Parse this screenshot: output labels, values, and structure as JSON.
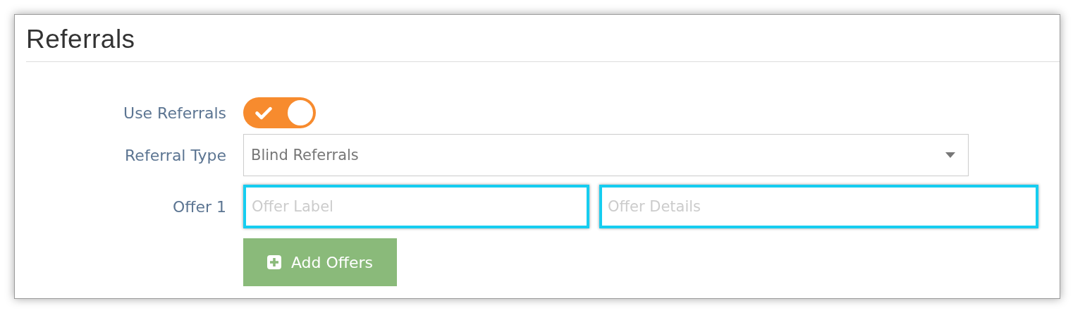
{
  "panel": {
    "title": "Referrals"
  },
  "use_referrals": {
    "label": "Use Referrals",
    "on": true
  },
  "referral_type": {
    "label": "Referral Type",
    "value": "Blind Referrals"
  },
  "offer": {
    "label": "Offer 1",
    "fields": [
      {
        "placeholder": "Offer Label",
        "highlighted": true
      },
      {
        "placeholder": "Offer Details",
        "highlighted": true
      }
    ]
  },
  "add_button": {
    "label": "Add Offers"
  }
}
